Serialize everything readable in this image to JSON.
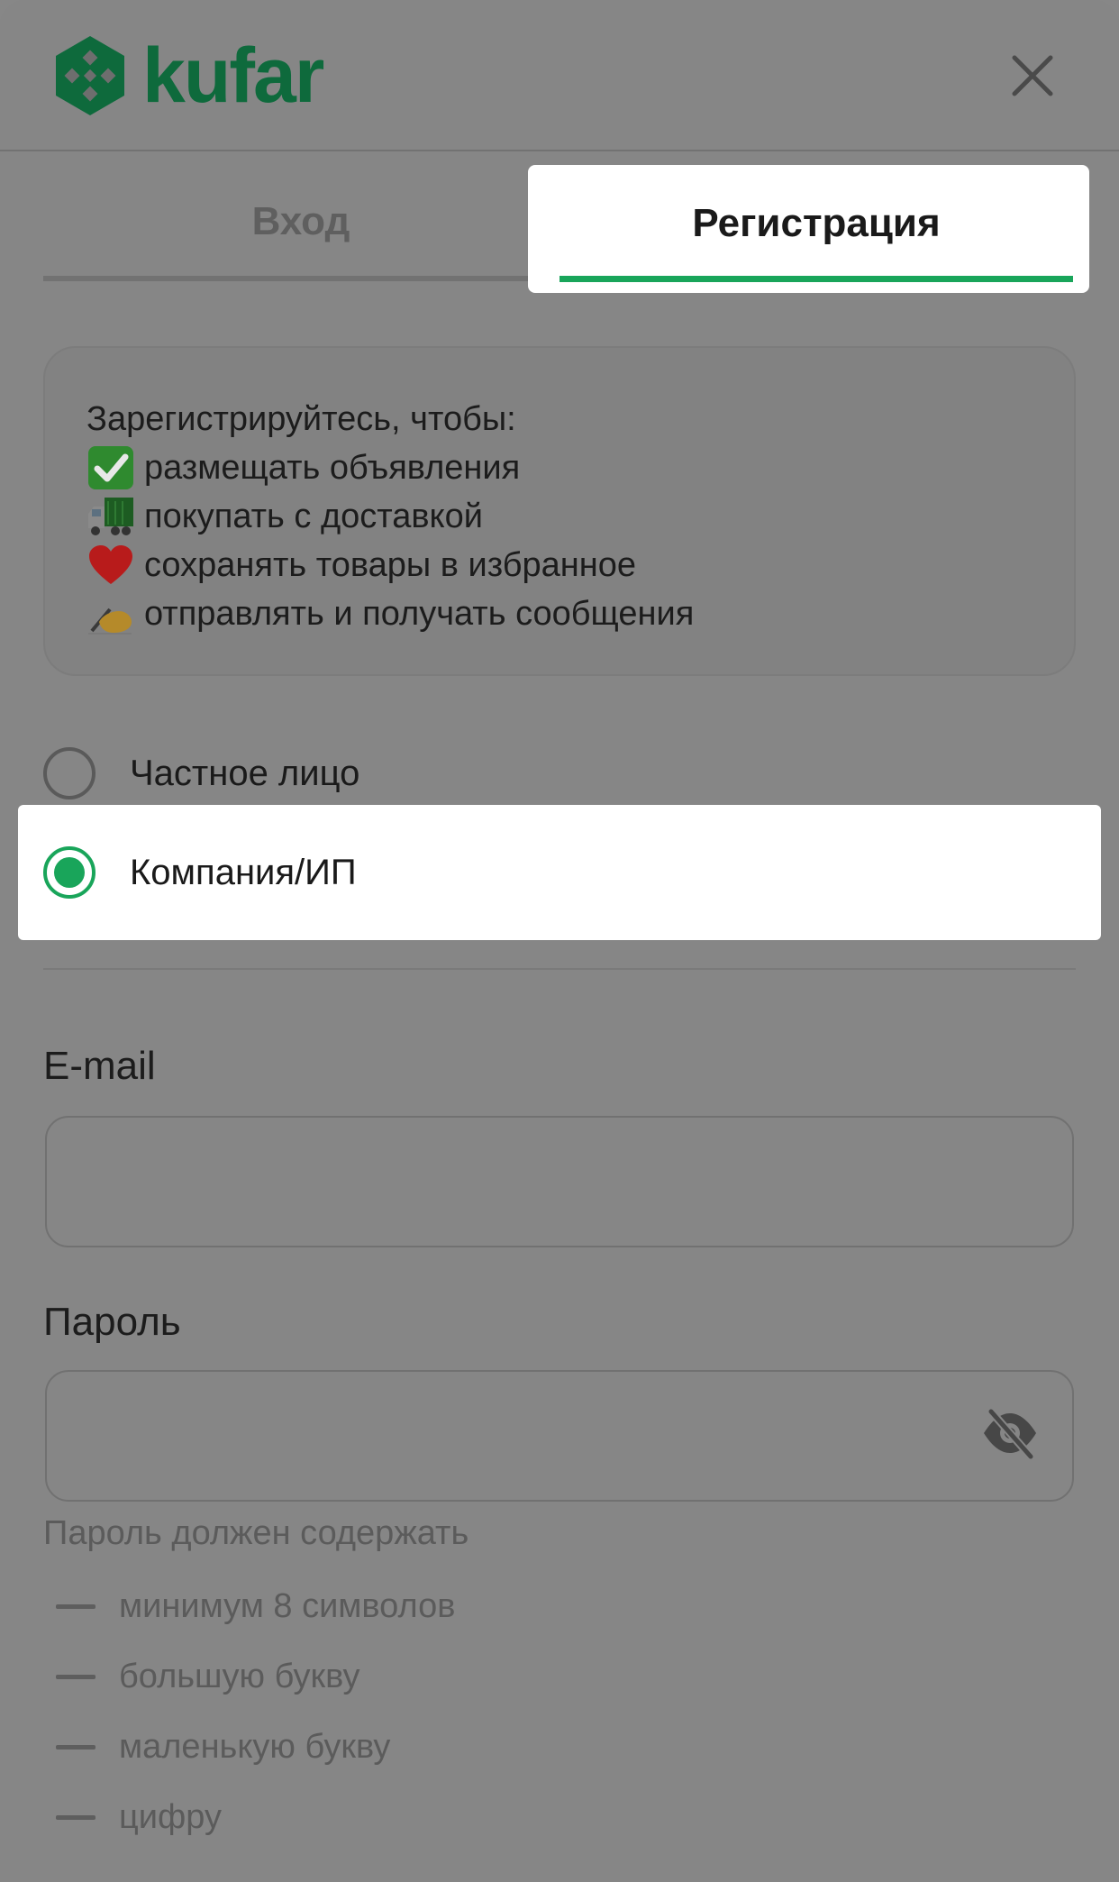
{
  "header": {
    "logo_text": "kufar",
    "logo_icon": "kufar-logo-mark",
    "close_icon": "close-icon"
  },
  "tabs": [
    {
      "label": "Вход",
      "active": false
    },
    {
      "label": "Регистрация",
      "active": true
    }
  ],
  "info": {
    "title": "Зарегистрируйтесь, чтобы:",
    "items": [
      {
        "icon": "check-mark-emoji",
        "text": "размещать объявления"
      },
      {
        "icon": "truck-emoji",
        "text": "покупать с доставкой"
      },
      {
        "icon": "heart-emoji",
        "text": "сохранять товары в избранное"
      },
      {
        "icon": "writing-hand-emoji",
        "text": "отправлять и получать сообщения"
      }
    ]
  },
  "account_type": {
    "options": [
      {
        "label": "Частное лицо",
        "selected": false
      },
      {
        "label": "Компания/ИП",
        "selected": true
      }
    ]
  },
  "form": {
    "email_label": "E-mail",
    "email_value": "",
    "password_label": "Пароль",
    "password_value": "",
    "password_toggle_icon": "eye-slash-icon"
  },
  "password_rules": {
    "title": "Пароль должен содержать",
    "items": [
      "минимум 8 символов",
      "большую букву",
      "маленькую букву",
      "цифру"
    ]
  },
  "colors": {
    "accent": "#19a55a",
    "brand": "#0e6a3c",
    "overlay": "#868686"
  }
}
